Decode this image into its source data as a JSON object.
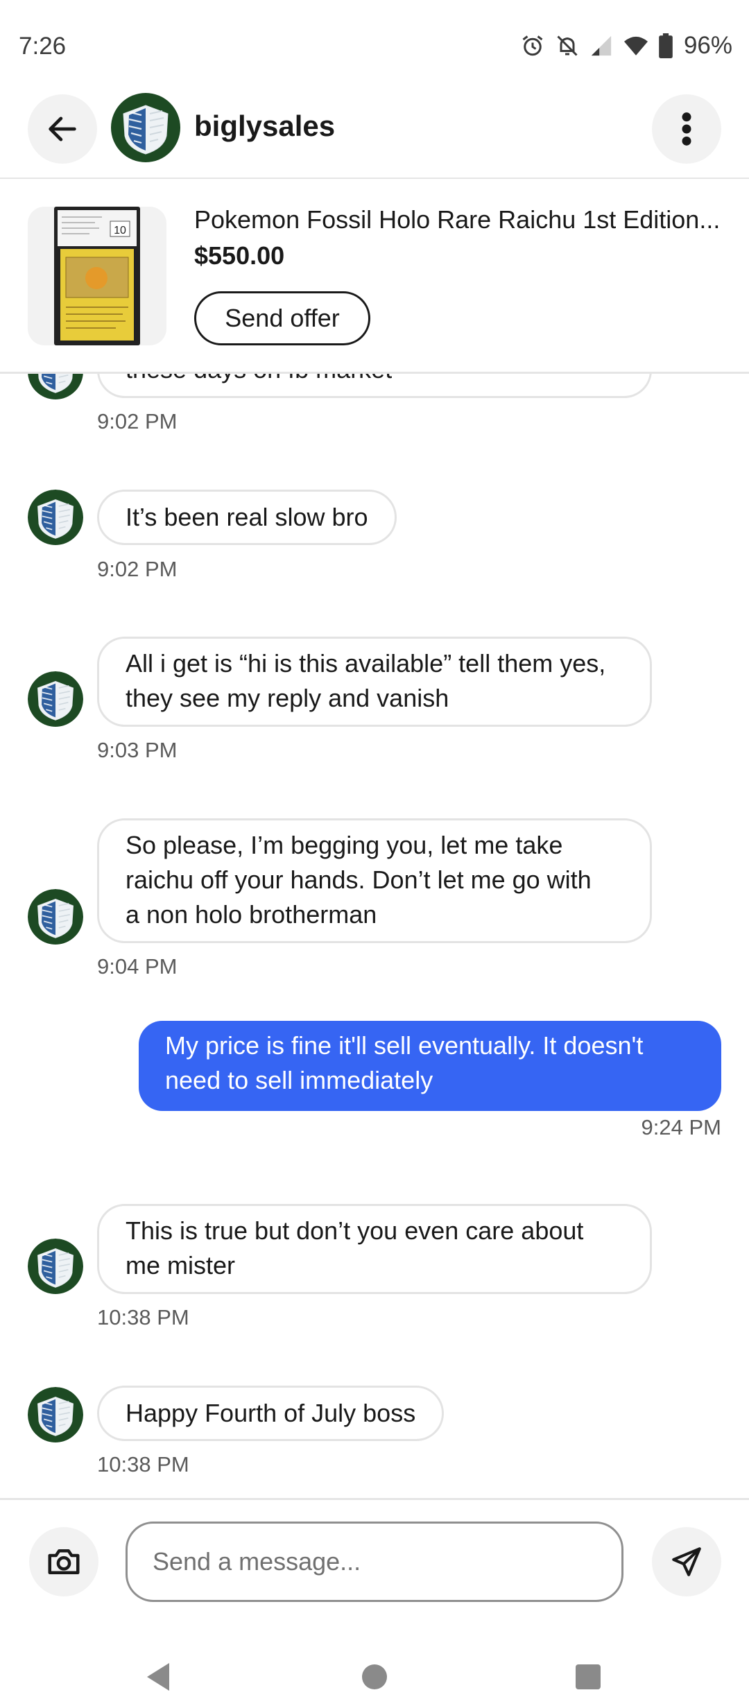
{
  "status_bar": {
    "time": "7:26",
    "battery": "96%"
  },
  "header": {
    "seller": "biglysales"
  },
  "item": {
    "title": "Pokemon Fossil Holo Rare Raichu 1st Edition...",
    "price": "$550.00",
    "send_offer": "Send offer",
    "card_grade": "10"
  },
  "messages": [
    {
      "text": "these days on fb market",
      "time": "9:02 PM"
    },
    {
      "text": "It’s been real slow bro",
      "time": "9:02 PM"
    },
    {
      "text_lines": [
        "All i get is “hi is this available” tell them yes,",
        "they see my reply and vanish"
      ],
      "time": "9:03 PM"
    },
    {
      "text_lines": [
        "So please, I’m begging you, let me take",
        "raichu off your hands. Don’t let me go with",
        "a non holo brotherman"
      ],
      "time": "9:04 PM"
    },
    {
      "text_lines": [
        "My price is fine it'll sell eventually. It doesn't",
        "need to sell immediately"
      ],
      "time": "9:24 PM",
      "outgoing": true
    },
    {
      "text_lines": [
        "This is true but don’t you even care about",
        "me mister"
      ],
      "time": "10:38 PM"
    },
    {
      "text": "Happy Fourth of July boss",
      "time": "10:38 PM"
    }
  ],
  "composer": {
    "placeholder": "Send a message..."
  },
  "colors": {
    "accent": "#3665f3",
    "avatar_bg": "#1d4a23"
  }
}
